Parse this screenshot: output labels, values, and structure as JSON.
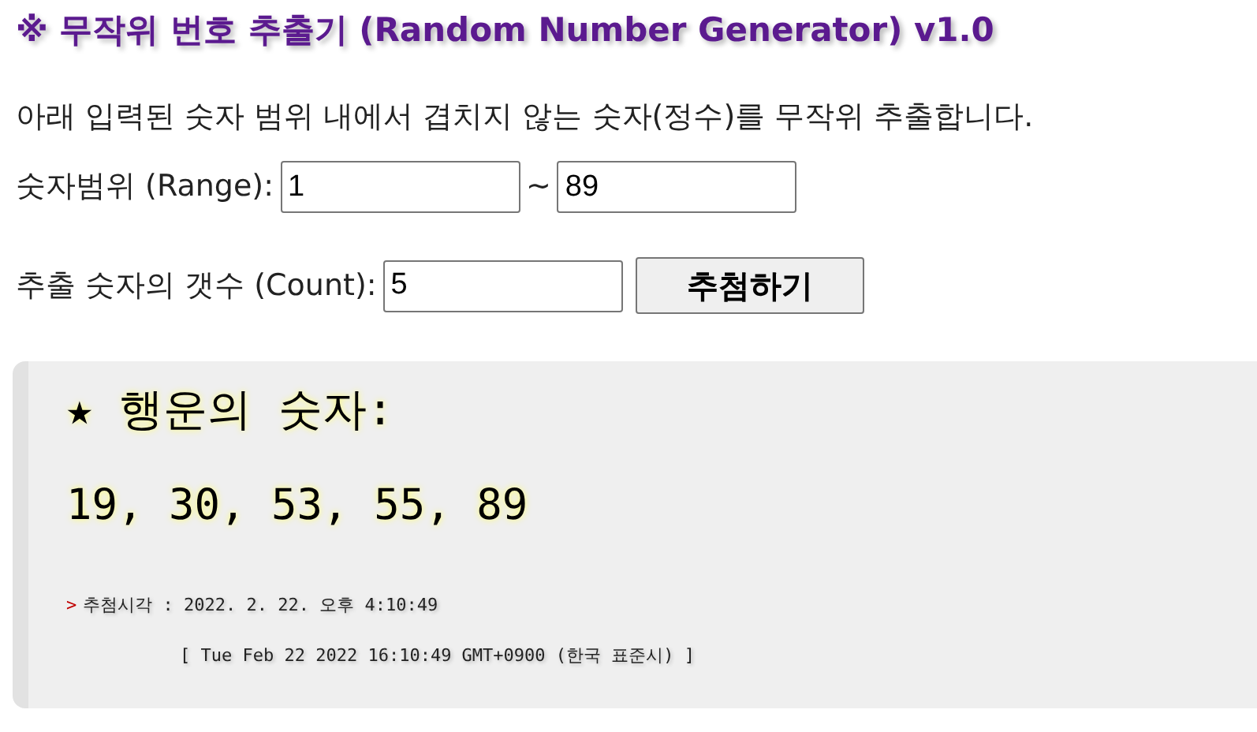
{
  "title": "※ 무작위 번호 추출기 (Random Number Generator) v1.0",
  "description": "아래 입력된 숫자 범위 내에서 겹치지 않는 숫자(정수)를 무작위 추출합니다.",
  "range": {
    "label": "숫자범위 (Range):",
    "from": "1",
    "separator": "~",
    "to": "89"
  },
  "count": {
    "label": "추출 숫자의 갯수 (Count):",
    "value": "5"
  },
  "draw_button": "추첨하기",
  "result": {
    "heading": "★ 행운의 숫자:",
    "numbers": "19, 30, 53, 55, 89",
    "marker": ">",
    "time_label": "추첨시각 : 2022. 2. 22. 오후 4:10:49",
    "time_full": "[ Tue Feb 22 2022 16:10:49 GMT+0900 (한국 표준시) ]"
  }
}
